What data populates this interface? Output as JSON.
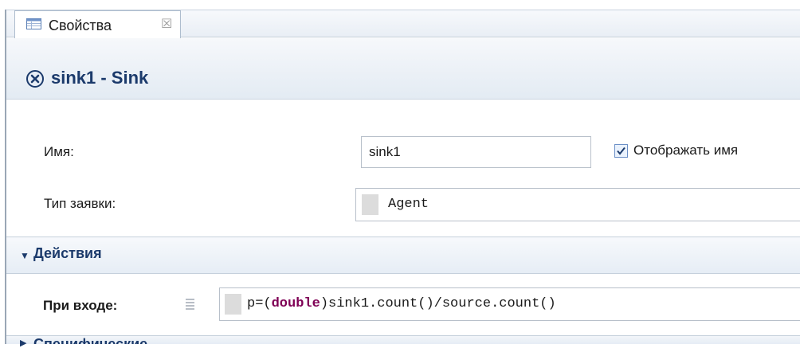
{
  "tab": {
    "label": "Свойства",
    "close_glyph": "☒"
  },
  "header": {
    "title": "sink1 - Sink",
    "icon": "close-circle-icon"
  },
  "form": {
    "name_label": "Имя:",
    "name_value": "sink1",
    "show_name_label": "Отображать имя",
    "show_name_checked": true,
    "agent_type_label": "Тип заявки:",
    "agent_type_value": "Agent"
  },
  "actions": {
    "section_title": "Действия",
    "on_enter_label": "При входе:",
    "on_enter_code_prefix": "p=(",
    "on_enter_code_keyword": "double",
    "on_enter_code_suffix": ")sink1.count()/source.count()"
  },
  "next_section": {
    "title": "Специфические"
  },
  "colors": {
    "title_blue": "#1b3a6b",
    "keyword": "#7f0055",
    "border": "#b8c0ca"
  }
}
